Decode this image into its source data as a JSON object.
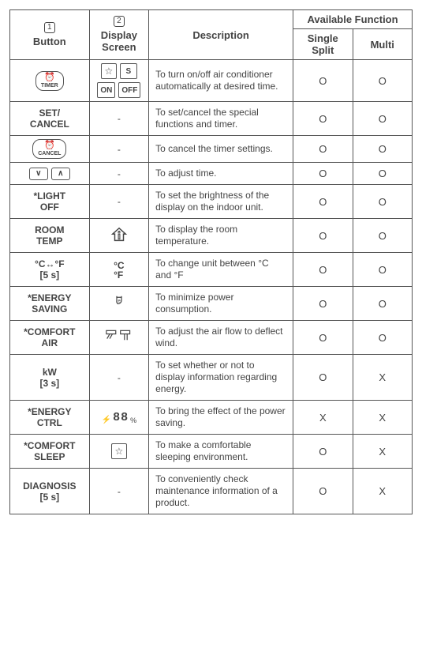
{
  "headers": {
    "button_num": "1",
    "button": "Button",
    "screen_num": "2",
    "screen": "Display Screen",
    "description": "Description",
    "available": "Available Function",
    "single": "Single Split",
    "multi": "Multi"
  },
  "icons": {
    "timer_label": "TIMER",
    "cancel_label": "CANCEL",
    "s": "S",
    "on": "ON",
    "off": "OFF",
    "down": "∨",
    "up": "∧",
    "dash": "-",
    "c": "°C",
    "f": "°F",
    "eighty_eight": "88",
    "percent": "%",
    "bolt": "⚡"
  },
  "rows": [
    {
      "button_type": "timer",
      "screen_type": "timer-screen",
      "description": "To turn on/off air conditioner automatically at desired time.",
      "single": "O",
      "multi": "O"
    },
    {
      "button_type": "text",
      "button_text": "SET/\nCANCEL",
      "screen_type": "dash",
      "description": "To set/cancel the special functions and timer.",
      "single": "O",
      "multi": "O"
    },
    {
      "button_type": "cancel",
      "screen_type": "dash",
      "description": "To cancel the timer settings.",
      "single": "O",
      "multi": "O"
    },
    {
      "button_type": "arrows",
      "screen_type": "dash",
      "description": "To adjust time.",
      "single": "O",
      "multi": "O"
    },
    {
      "button_type": "text",
      "button_text": "*LIGHT\nOFF",
      "screen_type": "dash",
      "description": "To set the brightness of the display on the indoor unit.",
      "single": "O",
      "multi": "O"
    },
    {
      "button_type": "text",
      "button_text": "ROOM\nTEMP",
      "screen_type": "house",
      "description": "To display the room temperature.",
      "single": "O",
      "multi": "O"
    },
    {
      "button_type": "text",
      "button_text": "°C↔°F\n[5 s]",
      "screen_type": "cf",
      "description": "To change unit between °C and °F",
      "single": "O",
      "multi": "O"
    },
    {
      "button_type": "text",
      "button_text": "*ENERGY\nSAVING",
      "screen_type": "eco",
      "description": "To minimize power consumption.",
      "single": "O",
      "multi": "O"
    },
    {
      "button_type": "text",
      "button_text": "*COMFORT\nAIR",
      "screen_type": "airflow",
      "description": "To adjust the air flow to deflect wind.",
      "single": "O",
      "multi": "O"
    },
    {
      "button_type": "text",
      "button_text": "kW\n[3 s]",
      "screen_type": "dash",
      "description": "To set whether or not to display information regarding energy.",
      "single": "O",
      "multi": "X"
    },
    {
      "button_type": "text",
      "button_text": "*ENERGY\nCTRL",
      "screen_type": "seg88",
      "description": "To bring the effect of the power saving.",
      "single": "X",
      "multi": "X"
    },
    {
      "button_type": "text",
      "button_text": "*COMFORT\nSLEEP",
      "screen_type": "star",
      "description": "To make a comfortable sleeping environment.",
      "single": "O",
      "multi": "X"
    },
    {
      "button_type": "text",
      "button_text": "DIAGNOSIS\n[5 s]",
      "screen_type": "dash",
      "description": "To conveniently check maintenance information of a product.",
      "single": "O",
      "multi": "X"
    }
  ]
}
